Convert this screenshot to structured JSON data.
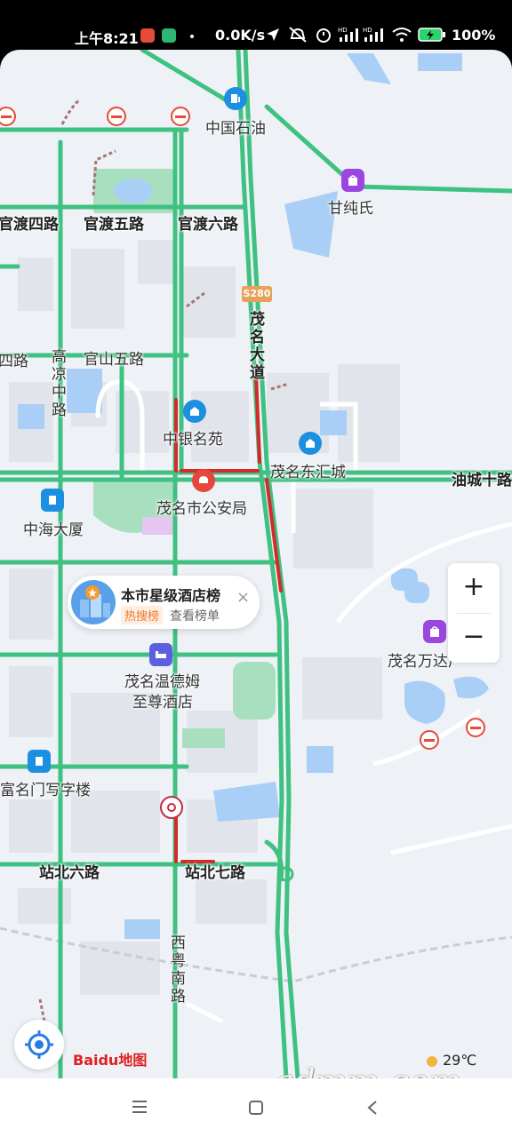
{
  "status_bar": {
    "time": "上午8:21",
    "net_speed": "0.0K/s",
    "battery": "100%"
  },
  "map": {
    "shield": "S280",
    "roads": {
      "guandu4": "官渡四路",
      "guandu5": "官渡五路",
      "guandu6": "官渡六路",
      "guanshan4": "四路",
      "guanshan5": "官山五路",
      "gaoliang": "高凉中路",
      "maoming_dadao": "茂名大道",
      "youcheng10": "油城十路",
      "zhanbei6": "站北六路",
      "zhanbei7": "站北七路",
      "xiyue_nan": "西粤南路"
    },
    "places": {
      "sinopec": "中国石油",
      "ganchunshi": "甘纯氏",
      "zhongyin": "中银名苑",
      "donghui": "茂名东汇城",
      "police": "茂名市公安局",
      "zhonghai": "中海大厦",
      "wendeham": "茂名温德姆至尊酒店",
      "wendeham_l1": "茂名温德姆",
      "wendeham_l2": "至尊酒店",
      "fuming": "富名门写字楼",
      "wanda": "茂名万达广场"
    },
    "wanda_visible": "茂名万达广"
  },
  "hotel_card": {
    "title": "本市星级酒店榜",
    "tag": "热搜榜",
    "link": "查看榜单",
    "close": "×"
  },
  "zoom": {
    "in": "+",
    "out": "−"
  },
  "baidu_logo": "Baidu地图",
  "weather": "29℃",
  "watermark": "gdmm.com",
  "icons": {
    "locate": "locate-icon",
    "gas": "gas-station-icon",
    "shopping": "shopping-bag-icon",
    "building": "building-icon",
    "police": "police-icon",
    "hotel": "hotel-bed-icon",
    "metro": "metro-icon",
    "no_parking": "no-parking-icon"
  },
  "colors": {
    "road_green": "#3fc181",
    "congestion_red": "#d42a2a",
    "map_bg": "#eef1f6",
    "water": "#a9cff6",
    "park": "#a8e0bf"
  }
}
